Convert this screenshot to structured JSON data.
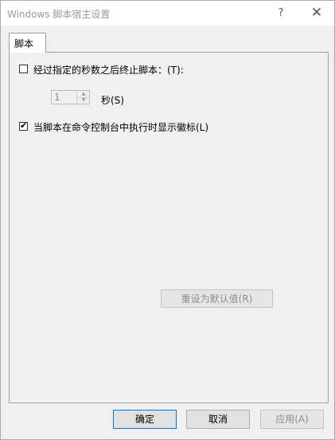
{
  "window": {
    "title": "Windows 脚本宿主设置",
    "help_label": "?",
    "close_label": "✕"
  },
  "tabs": [
    {
      "label": "脚本"
    }
  ],
  "script": {
    "stop_after": {
      "checked": false,
      "label": "经过指定的秒数之后终止脚本：(T):"
    },
    "seconds": {
      "value": "1",
      "unit_label": "秒(S)"
    },
    "show_logo": {
      "checked": true,
      "label": "当脚本在命令控制台中执行时显示徽标(L)"
    },
    "reset_label": "重设为默认值(R)"
  },
  "buttons": {
    "ok": "确定",
    "cancel": "取消",
    "apply": "应用(A)"
  }
}
